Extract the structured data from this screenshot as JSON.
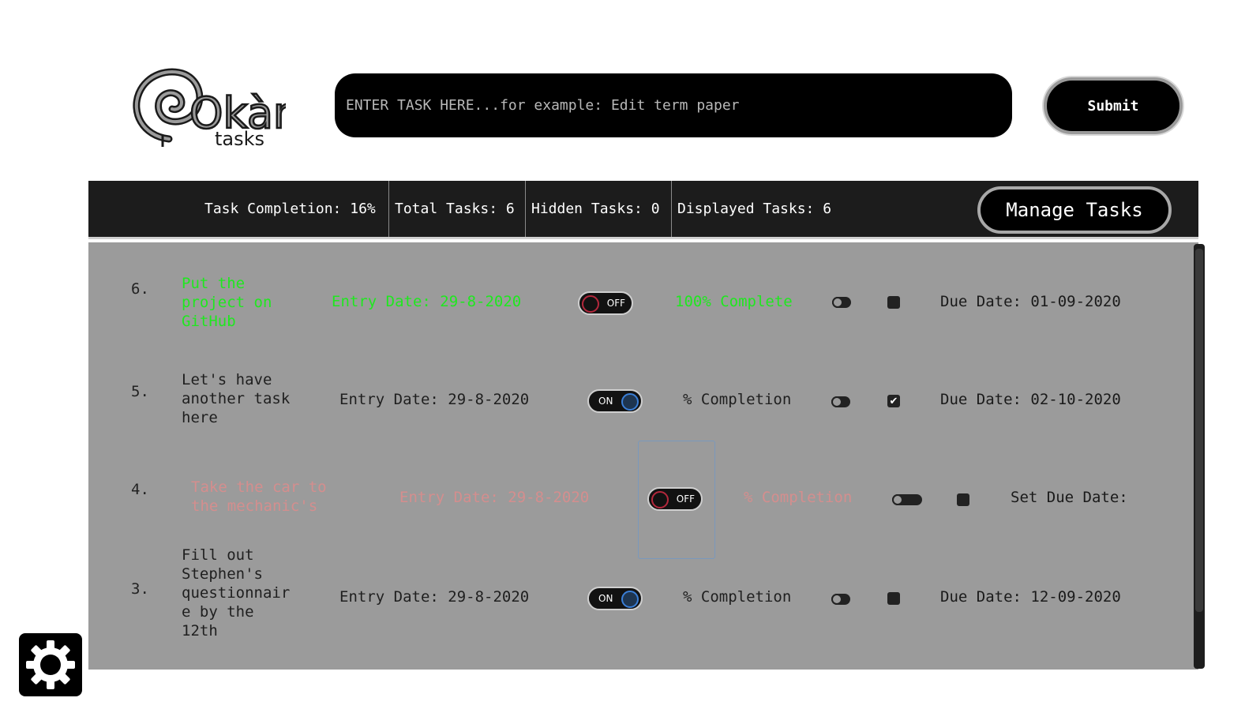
{
  "logo": {
    "wordmark": "Okàn",
    "subtitle": "tasks"
  },
  "task_input": {
    "placeholder": "ENTER TASK HERE...for example: Edit term paper",
    "value": ""
  },
  "submit": {
    "label": "Submit"
  },
  "stats": {
    "completion": "Task Completion: 16%",
    "total": "Total Tasks: 6",
    "hidden": "Hidden Tasks: 0",
    "displayed": "Displayed Tasks: 6",
    "manage_label": "Manage Tasks"
  },
  "tasks": [
    {
      "number": "6.",
      "text": "Put the\nproject on\nGitHub",
      "entry": "Entry Date: 29-8-2020",
      "toggle": "OFF",
      "completion": "100% Complete",
      "checked": false,
      "checkbox_mark": "",
      "due": "Due Date: 01-09-2020",
      "color": "#1fe81f"
    },
    {
      "number": "5.",
      "text": "Let's have\nanother task\nhere",
      "entry": "Entry Date: 29-8-2020",
      "toggle": "ON",
      "completion": "% Completion",
      "checked": true,
      "checkbox_mark": "✔",
      "due": "Due Date: 02-10-2020",
      "color": "#1f1f1f"
    },
    {
      "number": "4.",
      "text": "Take the car to\nthe mechanic's",
      "entry": "Entry Date: 29-8-2020",
      "toggle": "OFF",
      "completion": "% Completion",
      "checked": false,
      "checkbox_mark": "",
      "due": "Set Due Date:",
      "color": "#d48e8e"
    },
    {
      "number": "3.",
      "text": "Fill out\nStephen's\nquestionnair\ne by the\n12th",
      "entry": "Entry Date: 29-8-2020",
      "toggle": "ON",
      "completion": "% Completion",
      "checked": false,
      "checkbox_mark": "",
      "due": "Due Date: 12-09-2020",
      "color": "#1f1f1f"
    }
  ],
  "settings": {
    "icon": "gear-icon"
  }
}
